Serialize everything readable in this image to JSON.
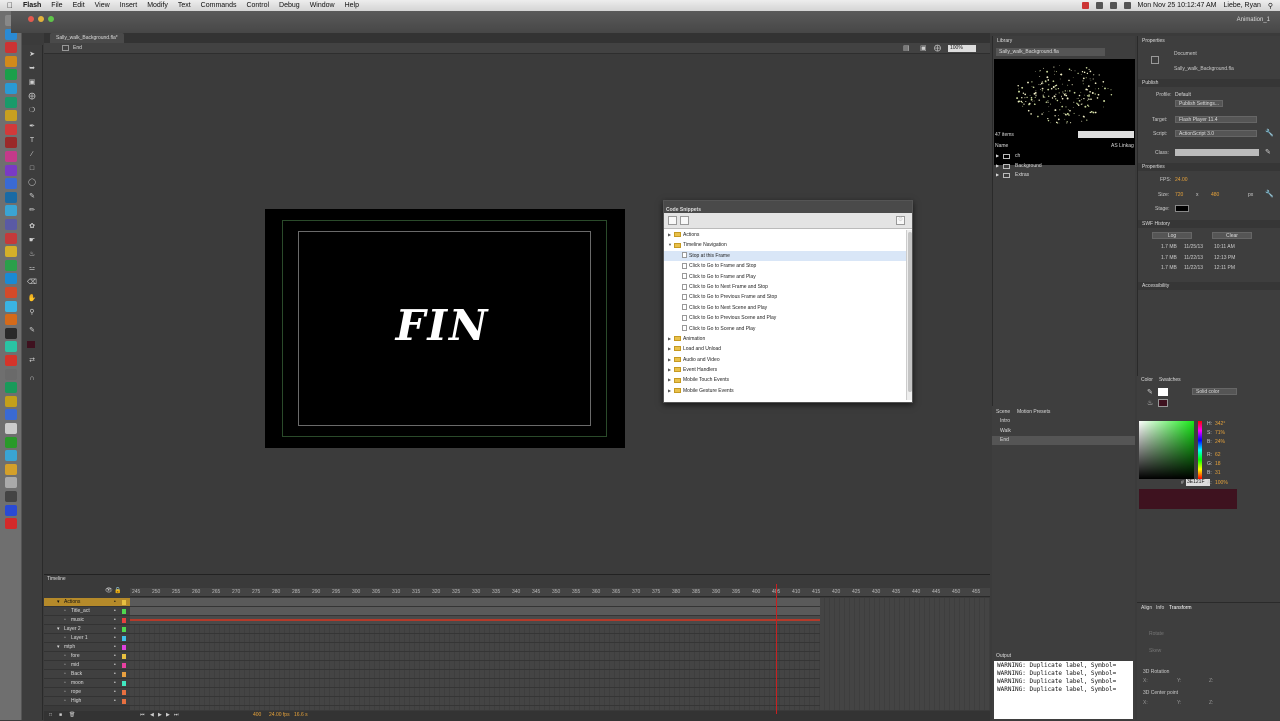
{
  "menubar": {
    "app": "Flash",
    "items": [
      "File",
      "Edit",
      "View",
      "Insert",
      "Modify",
      "Text",
      "Commands",
      "Control",
      "Debug",
      "Window",
      "Help"
    ],
    "clock": "Mon Nov 25  10:12:47 AM",
    "user": "Liebe, Ryan"
  },
  "window": {
    "workspace": "Animation_1"
  },
  "document": {
    "tab": "Sally_walk_Background.fla*",
    "scene": "End",
    "zoom": "100%"
  },
  "stage": {
    "text": "FIN",
    "background": "#000000"
  },
  "code_snippets": {
    "title": "Code Snippets",
    "rows": [
      {
        "label": "Actions",
        "type": "folder",
        "open": false
      },
      {
        "label": "Timeline Navigation",
        "type": "folder",
        "open": true
      },
      {
        "label": "Stop at this Frame",
        "type": "item",
        "selected": true
      },
      {
        "label": "Click to Go to Frame and Stop",
        "type": "item"
      },
      {
        "label": "Click to Go to Frame and Play",
        "type": "item"
      },
      {
        "label": "Click to Go to Next Frame and Stop",
        "type": "item"
      },
      {
        "label": "Click to Go to Previous Frame and Stop",
        "type": "item"
      },
      {
        "label": "Click to Go to Next Scene and Play",
        "type": "item"
      },
      {
        "label": "Click to Go to Previous Scene and Play",
        "type": "item"
      },
      {
        "label": "Click to Go to Scene and Play",
        "type": "item"
      },
      {
        "label": "Animation",
        "type": "folder",
        "open": false
      },
      {
        "label": "Load and Unload",
        "type": "folder",
        "open": false
      },
      {
        "label": "Audio and Video",
        "type": "folder",
        "open": false
      },
      {
        "label": "Event Handlers",
        "type": "folder",
        "open": false
      },
      {
        "label": "Mobile Touch Events",
        "type": "folder",
        "open": false
      },
      {
        "label": "Mobile Gesture Events",
        "type": "folder",
        "open": false
      }
    ]
  },
  "timeline": {
    "title": "Timeline",
    "ticks": [
      "245",
      "250",
      "255",
      "260",
      "265",
      "270",
      "275",
      "280",
      "285",
      "290",
      "295",
      "300",
      "305",
      "310",
      "315",
      "320",
      "325",
      "330",
      "335",
      "340",
      "345",
      "350",
      "355",
      "360",
      "365",
      "370",
      "375",
      "380",
      "385",
      "390",
      "395",
      "400",
      "405",
      "410",
      "415",
      "420",
      "425",
      "430",
      "435",
      "440",
      "445",
      "450",
      "455"
    ],
    "layers": [
      {
        "name": "Actions",
        "indent": 0,
        "selected": true,
        "color": "#e8c040"
      },
      {
        "name": "Title_act",
        "indent": 1,
        "color": "#4fd84f"
      },
      {
        "name": "music",
        "indent": 1,
        "color": "#e84040"
      },
      {
        "name": "Layer 2",
        "indent": 0,
        "color": "#4fd84f"
      },
      {
        "name": "Layer 1",
        "indent": 1,
        "color": "#40c0e8"
      },
      {
        "name": "mtph",
        "indent": 0,
        "color": "#e040e0"
      },
      {
        "name": "fore",
        "indent": 1,
        "color": "#e8c040"
      },
      {
        "name": "mid",
        "indent": 1,
        "color": "#e840a0"
      },
      {
        "name": "Back",
        "indent": 1,
        "color": "#e8a040"
      },
      {
        "name": "moon",
        "indent": 1,
        "color": "#40e8c0"
      },
      {
        "name": "rope",
        "indent": 1,
        "color": "#e87040"
      },
      {
        "name": "High",
        "indent": 1,
        "color": "#e87040"
      }
    ],
    "status": {
      "frame": "400",
      "fps": "24.00 fps",
      "time": "16.6 s"
    }
  },
  "library": {
    "title": "Library",
    "file": "Sally_walk_Background.fla",
    "count": "47 items",
    "col_name": "Name",
    "col_linkage": "AS Linkag",
    "items": [
      "ch",
      "Background",
      "Extras"
    ]
  },
  "scene_panel": {
    "tabs": [
      "Scene",
      "Motion Presets"
    ],
    "scenes": [
      "Intro",
      "Walk",
      "End"
    ]
  },
  "output": {
    "title": "Output",
    "lines": [
      "WARNING: Duplicate label, Symbol=",
      "WARNING: Duplicate label, Symbol=",
      "WARNING: Duplicate label, Symbol=",
      "WARNING: Duplicate label, Symbol="
    ]
  },
  "properties": {
    "title": "Properties",
    "doc_type": "Document",
    "doc_name": "Sally_walk_Background.fla",
    "publish_section": "Publish",
    "profile_label": "Profile:",
    "profile_value": "Default",
    "publish_settings": "Publish Settings...",
    "target_label": "Target:",
    "target_value": "Flash Player 11.4",
    "script_label": "Script:",
    "script_value": "ActionScript 3.0",
    "class_label": "Class:",
    "properties_section": "Properties",
    "fps_label": "FPS:",
    "fps_value": "24.00",
    "size_label": "Size:",
    "size_w": "720",
    "size_x": "x",
    "size_h": "480",
    "size_unit": "px",
    "stage_label": "Stage:",
    "swf_section": "SWF History",
    "log_button": "Log",
    "clear_button": "Clear",
    "history": [
      {
        "size": "1.7 MB",
        "date": "11/25/13",
        "time": "10:11 AM"
      },
      {
        "size": "1.7 MB",
        "date": "11/22/13",
        "time": "12:13 PM"
      },
      {
        "size": "1.7 MB",
        "date": "11/22/13",
        "time": "12:11 PM"
      }
    ],
    "accessibility_section": "Accessibility"
  },
  "color_panel": {
    "tabs": [
      "Color",
      "Swatches"
    ],
    "type": "Solid color",
    "h": "342°",
    "s": "71%",
    "b": "24%",
    "r": "62",
    "g": "18",
    "bl": "31",
    "hex": "3E121F",
    "alpha": "100%",
    "current_color": "#3e121f"
  },
  "transform_panel": {
    "tabs": [
      "Align",
      "Info",
      "Transform"
    ],
    "rotate": "Rotate",
    "skew": "Skew",
    "rotation3d": "3D Rotation",
    "center3d": "3D Center point",
    "x": "X:",
    "y": "Y:",
    "z": "Z:"
  }
}
